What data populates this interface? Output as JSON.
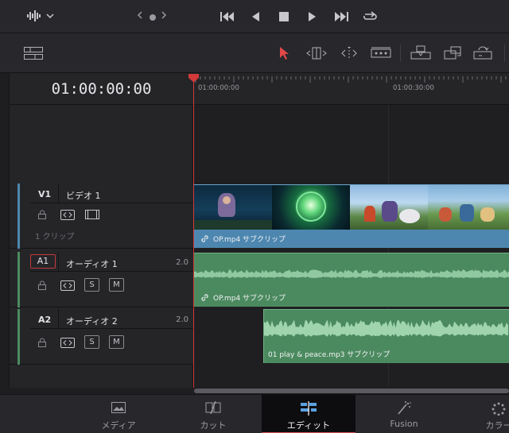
{
  "timecode": "01:00:00:00",
  "ruler": {
    "labels": [
      "01:00:00:00",
      "01:00:30:00"
    ]
  },
  "tracks": {
    "v1": {
      "id": "V1",
      "name": "ビデオ 1",
      "clip_count": "1 クリップ"
    },
    "a1": {
      "id": "A1",
      "name": "オーディオ 1",
      "channels": "2.0",
      "solo": "S",
      "mute": "M"
    },
    "a2": {
      "id": "A2",
      "name": "オーディオ 2",
      "channels": "2.0",
      "solo": "S",
      "mute": "M"
    }
  },
  "clips": {
    "video": "OP.mp4 サブクリップ",
    "audio1": "OP.mp4 サブクリップ",
    "audio2": "01 play & peace.mp3 サブクリップ"
  },
  "pages": [
    {
      "label": "メディア",
      "icon": "media-page-icon"
    },
    {
      "label": "カット",
      "icon": "cut-page-icon"
    },
    {
      "label": "エディット",
      "icon": "edit-page-icon",
      "active": true
    },
    {
      "label": "Fusion",
      "icon": "fusion-page-icon"
    },
    {
      "label": "カラー",
      "icon": "color-page-icon"
    }
  ],
  "colors": {
    "video_track": "#4d87b0",
    "audio_track": "#4b8a5f",
    "playhead": "#d23a3a",
    "active_tab_underline": "#d95050",
    "a1_selected_border": "#c03a3a"
  }
}
